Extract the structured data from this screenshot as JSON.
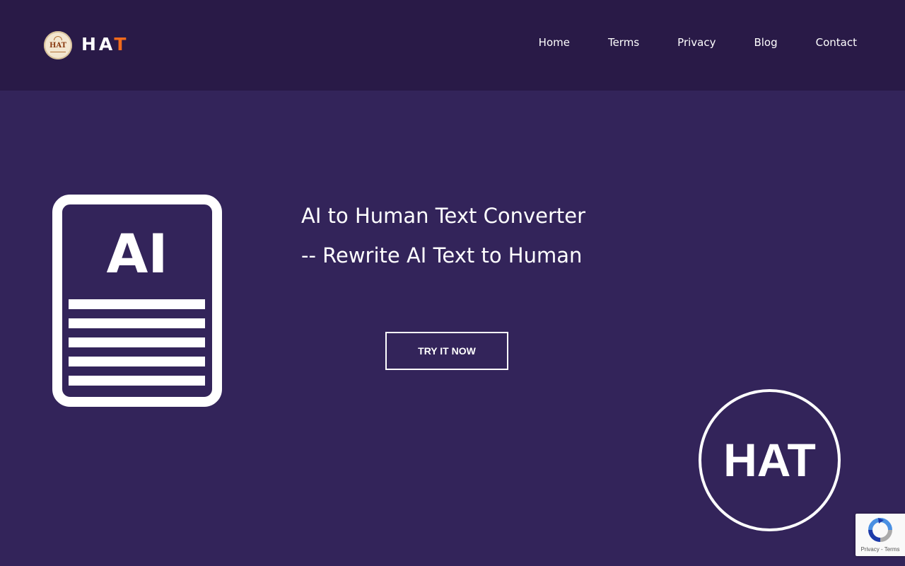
{
  "header": {
    "logo_badge_text": "HAT",
    "brand_main": "HA",
    "brand_accent": "T"
  },
  "nav": {
    "items": [
      {
        "label": "Home"
      },
      {
        "label": "Terms"
      },
      {
        "label": "Privacy"
      },
      {
        "label": "Blog"
      },
      {
        "label": "Contact"
      }
    ]
  },
  "hero": {
    "doc_icon_label": "AI",
    "title": "AI to Human Text Converter",
    "subtitle": "-- Rewrite AI Text to Human",
    "cta_label": "TRY IT NOW",
    "circle_logo_text": "HAT"
  },
  "recaptcha": {
    "privacy_label": "Privacy",
    "separator": " - ",
    "terms_label": "Terms"
  },
  "colors": {
    "page_bg": "#33245a",
    "header_bg": "#291a47",
    "accent": "#f26a1b",
    "text": "#ffffff"
  }
}
